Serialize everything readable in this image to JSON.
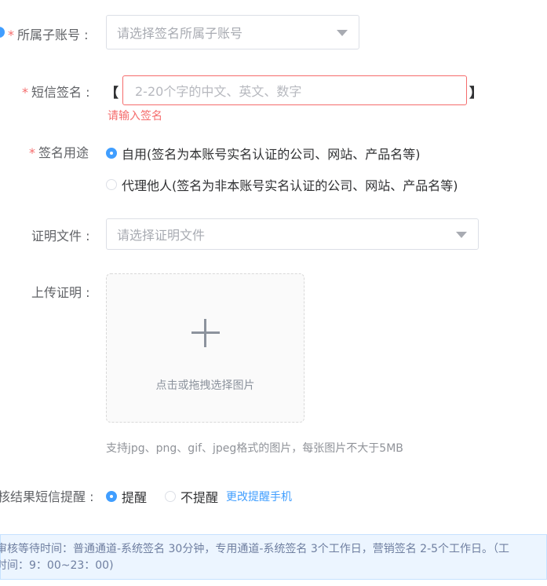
{
  "sub_account": {
    "label": "所属子账号 :",
    "placeholder": "请选择签名所属子账号"
  },
  "signature": {
    "label": "短信签名 :",
    "open_bracket": "【",
    "close_bracket": "】",
    "placeholder": "2-20个字的中文、英文、数字",
    "error": "请输入签名"
  },
  "purpose": {
    "label": "签名用途",
    "options": [
      {
        "label": "自用(签名为本账号实名认证的公司、网站、产品名等)",
        "selected": true
      },
      {
        "label": "代理他人(签名为非本账号实名认证的公司、网站、产品名等)",
        "selected": false
      }
    ]
  },
  "proof_file": {
    "label": "证明文件 :",
    "placeholder": "请选择证明文件"
  },
  "upload": {
    "label": "上传证明 :",
    "text": "点击或拖拽选择图片",
    "hint": "支持jpg、png、gif、jpeg格式的图片，每张图片不大于5MB"
  },
  "sms_reminder": {
    "label": "核结果短信提醒 :",
    "options": [
      {
        "label": "提醒",
        "selected": true
      },
      {
        "label": "不提醒",
        "selected": false
      }
    ],
    "link": "更改提醒手机"
  },
  "notice": {
    "line1": "审核等待时间：普通通道-系统签名 30分钟，专用通道-系统签名 3个工作日，营销签名 2-5个工作日。（工",
    "line2": "时间：9：00~23：00)"
  },
  "colors": {
    "accent": "#409eff",
    "error": "#f56c6c"
  }
}
